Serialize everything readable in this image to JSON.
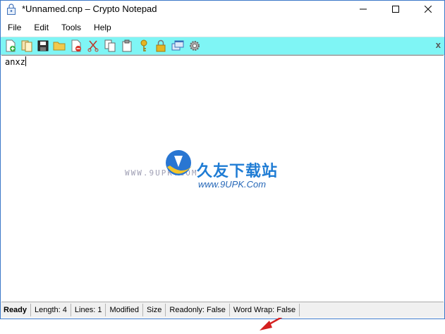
{
  "window": {
    "title": "*Unnamed.cnp – Crypto Notepad"
  },
  "menu": [
    {
      "label": "File"
    },
    {
      "label": "Edit"
    },
    {
      "label": "Tools"
    },
    {
      "label": "Help"
    }
  ],
  "toolbar": {
    "buttons": [
      {
        "name": "new-file-icon"
      },
      {
        "name": "open-file-icon"
      },
      {
        "name": "save-icon"
      },
      {
        "name": "open-folder-icon"
      },
      {
        "name": "delete-file-icon"
      },
      {
        "name": "cut-icon"
      },
      {
        "name": "copy-icon"
      },
      {
        "name": "paste-icon"
      },
      {
        "name": "key-icon"
      },
      {
        "name": "lock-icon"
      },
      {
        "name": "windows-icon"
      },
      {
        "name": "settings-icon"
      }
    ],
    "close_label": "x",
    "background": "#7ff5f5"
  },
  "editor": {
    "content": "anxz"
  },
  "watermark": {
    "site_text": "WWW.9UPK.COM",
    "brand_cn": "久友下载站",
    "url": "www.9UPK.Com"
  },
  "status": {
    "state": "Ready",
    "length": "Length: 4",
    "lines": "Lines: 1",
    "modified": "Modified",
    "size": "Size",
    "readonly": "Readonly: False",
    "word_wrap": "Word Wrap: False"
  }
}
